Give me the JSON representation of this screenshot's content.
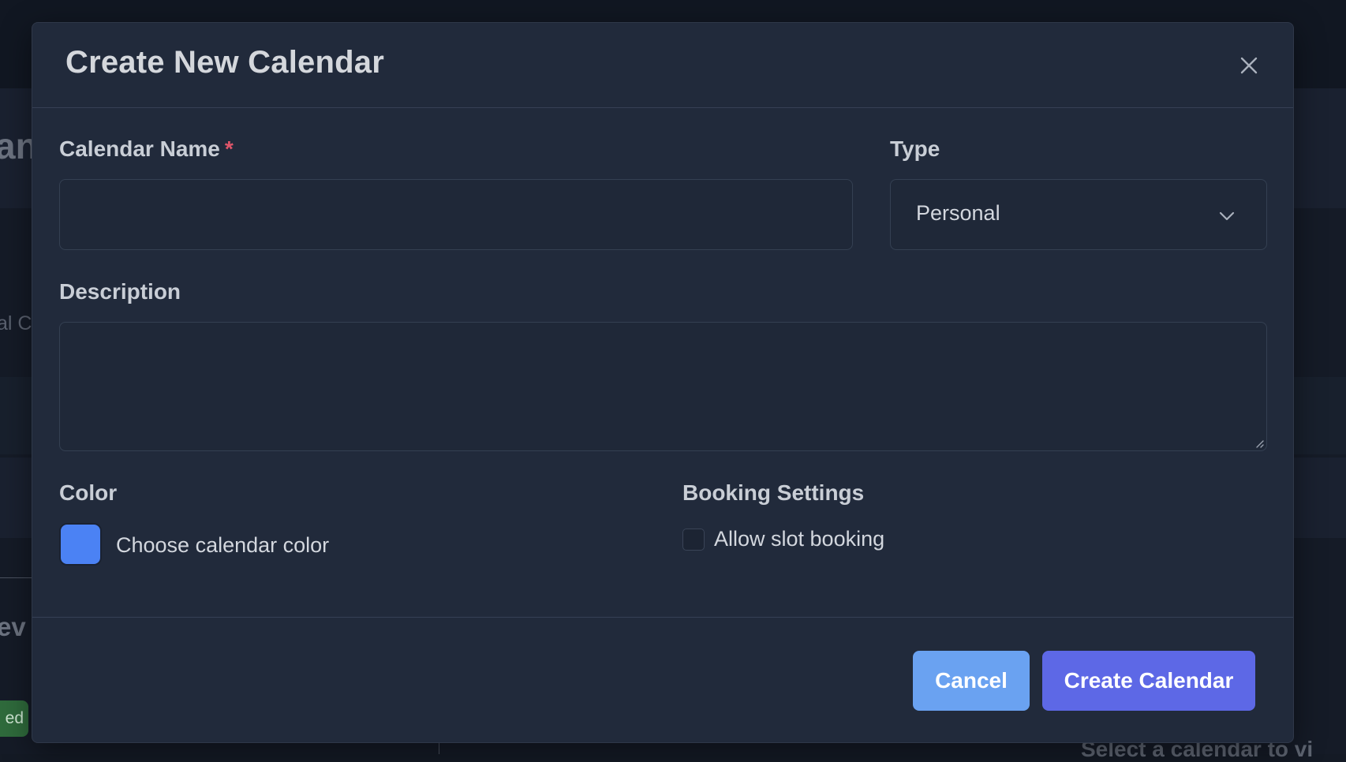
{
  "background": {
    "fragments": [
      "an",
      "al C",
      "ev",
      "ed",
      "Select a calendar to vi"
    ]
  },
  "modal": {
    "title": "Create New Calendar",
    "close_label": "×",
    "fields": {
      "name": {
        "label": "Calendar Name",
        "required_mark": "*",
        "value": "",
        "placeholder": ""
      },
      "type": {
        "label": "Type",
        "selected": "Personal"
      },
      "description": {
        "label": "Description",
        "value": "",
        "placeholder": ""
      }
    },
    "color": {
      "label": "Color",
      "swatch_label": "Choose calendar color",
      "value": "#4B82F4"
    },
    "booking": {
      "label": "Booking Settings",
      "checkbox_label": "Allow slot booking",
      "checked": false
    },
    "buttons": {
      "cancel": "Cancel",
      "create": "Create Calendar"
    }
  },
  "colors": {
    "modal_bg": "#212A3B",
    "primary": "#5D68E6",
    "secondary": "#6AA2F1",
    "required": "#E0566A"
  },
  "icons": {
    "close": "close-icon",
    "dropdown": "chevron-down-icon",
    "resize": "resize-handle-icon"
  }
}
